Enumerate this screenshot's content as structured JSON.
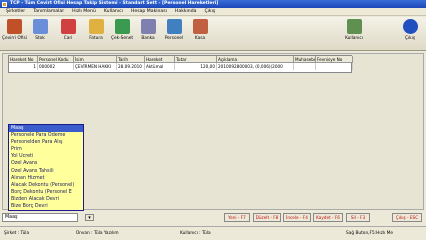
{
  "window": {
    "title": "TCP - Tüm Cevirt Ofisi Hesap Takip Sistemi - Standart Sett - [Personel Hareketleri]"
  },
  "menu": [
    "Şirketler",
    "Tanımlamalar",
    "Hızlı Menü",
    "Kullanıcı",
    "Hesap Makinası",
    "Hakkında",
    "Çıkış"
  ],
  "toolbar": {
    "buttons": [
      {
        "label": "Çevirri Ofisi",
        "icon": "people-icon",
        "color": "#c05028"
      },
      {
        "label": "Stok",
        "icon": "box-icon",
        "color": "#6a8fd8"
      },
      {
        "label": "Cari",
        "icon": "card-icon",
        "color": "#d04040"
      },
      {
        "label": "Fatura",
        "icon": "invoice-icon",
        "color": "#e0b040"
      },
      {
        "label": "Çek-Senet",
        "icon": "cheque-icon",
        "color": "#3a9a50"
      },
      {
        "label": "Banka",
        "icon": "bank-icon",
        "color": "#8080b0"
      },
      {
        "label": "Personel",
        "icon": "personnel-icon",
        "color": "#4080c0"
      },
      {
        "label": "Kasa",
        "icon": "safe-icon",
        "color": "#c06040"
      }
    ],
    "user_button": {
      "label": "Kullanıcı",
      "icon": "user-icon",
      "color": "#609050"
    },
    "exit_button": {
      "label": "Çıkış",
      "icon": "exit-icon",
      "color": "#2050c0"
    }
  },
  "grid": {
    "columns": [
      "Hareket No",
      "Personel Kodu",
      "İsim",
      "Tarih",
      "Hareket",
      "Tutar",
      "Açıklama",
      "Muhasebe",
      "Fevnisye No"
    ],
    "rows": [
      [
        "1",
        "000002",
        "ÇEVİRMEN HAKKI",
        "28.09.2010",
        "Aktümal",
        "120,00",
        "2010092800003, (0,006)(2000",
        "",
        ""
      ]
    ]
  },
  "dropdown": {
    "items": [
      "Maaş",
      "Personele Para Ödeme",
      "Personelden Para Alış",
      "Prim",
      "Yol Ücreti",
      "Özel Avans",
      "Özel Avans Tahsili",
      "Alınan Hizmet",
      "Alacak Dekontu (Personel)",
      "Borç Dekontu (Personel E",
      "Bizden Alacak Devri",
      "Bize Borç Devri"
    ],
    "selected": "Maaş"
  },
  "function_buttons": [
    "Yeni - F7",
    "Düzelt - F8",
    "İncele - F4",
    "Kaydet - F6",
    "Sil - F3",
    "Çıkış - ESC"
  ],
  "statusbar": {
    "company": "Şirket : Tüla",
    "user_title": "Ünvan : Tüla Yazılım",
    "user": "Kullanıcı : Tüla",
    "help": "Sağ Buton,F5:Hızlı Me"
  }
}
